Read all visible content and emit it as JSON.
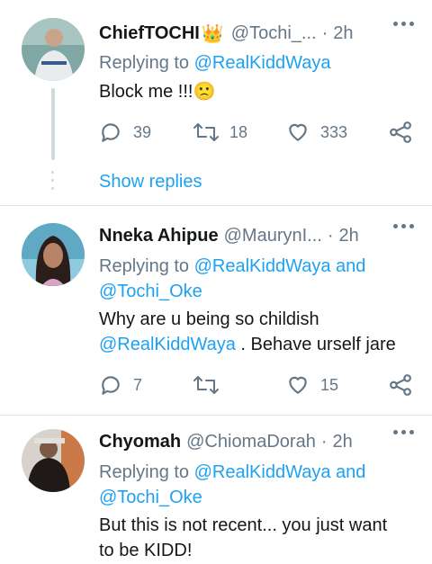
{
  "tweets": [
    {
      "name": "ChiefTOCHI",
      "badge": "👑",
      "handle": "@Tochi_...",
      "dot": "·",
      "time": "2h",
      "replying_prefix": "Replying to",
      "replying_to": "@RealKiddWaya",
      "text": "Block me !!!🙁",
      "reply_count": "39",
      "retweet_count": "18",
      "like_count": "333"
    },
    {
      "name": "Nneka Ahipue",
      "handle": "@MaurynI...",
      "dot": "·",
      "time": "2h",
      "replying_prefix": "Replying to",
      "replying_to": "@RealKiddWaya",
      "replying_and": "and",
      "replying_to_2": "@Tochi_Oke",
      "text_line1": "Why are u being so childish",
      "mention": "@RealKiddWaya",
      "text_line2_rest": ". Behave urself jare",
      "reply_count": "7",
      "retweet_count": "",
      "like_count": "15"
    },
    {
      "name": "Chyomah",
      "handle": "@ChiomaDorah",
      "dot": "·",
      "time": "2h",
      "replying_prefix": "Replying to",
      "replying_to": "@RealKiddWaya",
      "replying_and": "and",
      "replying_to_2": "@Tochi_Oke",
      "text_line1": "But this is not recent... you just want",
      "text_line2": "to be KIDD!"
    }
  ],
  "show_replies_label": "Show replies",
  "colors": {
    "accent": "#1da1f2",
    "muted": "#657786",
    "divider": "#e1e8ed"
  },
  "icons": [
    "reply-icon",
    "retweet-icon",
    "like-icon",
    "share-icon",
    "more-icon"
  ]
}
